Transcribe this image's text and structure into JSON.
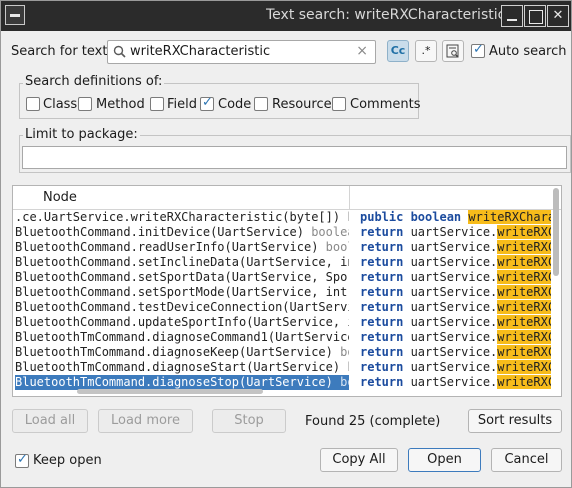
{
  "window": {
    "title": "Text search: writeRXCharacteristic"
  },
  "search": {
    "label": "Search for text:",
    "value": "writeRXCharacteristic",
    "auto_search_label": "Auto search",
    "auto_search_checked": true,
    "toggle_case_label": "Cc",
    "toggle_regex_label": ".*"
  },
  "definitions": {
    "title": "Search definitions of:",
    "items": [
      {
        "label": "Class",
        "checked": false
      },
      {
        "label": "Method",
        "checked": false
      },
      {
        "label": "Field",
        "checked": false
      },
      {
        "label": "Code",
        "checked": true
      },
      {
        "label": "Resource",
        "checked": false
      },
      {
        "label": "Comments",
        "checked": false
      }
    ]
  },
  "package": {
    "title": "Limit to package:",
    "value": ""
  },
  "table": {
    "header": "Node",
    "rows": [
      {
        "node": ".ce.UartService.writeRXCharacteristic(byte[])",
        "sig": " boo",
        "kw": "public boolean ",
        "pre": "",
        "hl": "writeRXCharac",
        "selected": false
      },
      {
        "node": "BluetoothCommand.initDevice(UartService)",
        "sig": " boolean",
        "kw": "return ",
        "pre": "uartService.",
        "hl": "writeRXCh",
        "selected": false
      },
      {
        "node": "BluetoothCommand.readUserInfo(UartService)",
        "sig": " boole",
        "kw": "return ",
        "pre": "uartService.",
        "hl": "writeRXCh",
        "selected": false
      },
      {
        "node": "BluetoothCommand.setInclineData(UartService, int",
        "sig": "",
        "kw": "return ",
        "pre": "uartService.",
        "hl": "writeRXCh",
        "selected": false
      },
      {
        "node": "BluetoothCommand.setSportData(UartService, Sport",
        "sig": "",
        "kw": "return ",
        "pre": "uartService.",
        "hl": "writeRXCh",
        "selected": false
      },
      {
        "node": "BluetoothCommand.setSportMode(UartService, int,",
        "sig": "",
        "kw": "return ",
        "pre": "uartService.",
        "hl": "writeRXCh",
        "selected": false
      },
      {
        "node": "BluetoothCommand.testDeviceConnection(UartServic",
        "sig": "",
        "kw": "return ",
        "pre": "uartService.",
        "hl": "writeRXCh",
        "selected": false
      },
      {
        "node": "BluetoothCommand.updateSportInfo(UartService, in",
        "sig": "",
        "kw": "return ",
        "pre": "uartService.",
        "hl": "writeRXCh",
        "selected": false
      },
      {
        "node": "BluetoothTmCommand.diagnoseCommand1(UartService,",
        "sig": "",
        "kw": "return ",
        "pre": "uartService.",
        "hl": "writeRXCh",
        "selected": false
      },
      {
        "node": "BluetoothTmCommand.diagnoseKeep(UartService)",
        "sig": " bo",
        "kw": "return ",
        "pre": "uartService.",
        "hl": "writeRXCh",
        "selected": false
      },
      {
        "node": "BluetoothTmCommand.diagnoseStart(UartService)",
        "sig": " bo",
        "kw": "return ",
        "pre": "uartService.",
        "hl": "writeRXCh",
        "selected": false
      },
      {
        "node": "BluetoothTmCommand.diagnoseStop(UartService)",
        "sig": " boo",
        "kw": "return ",
        "pre": "uartService.",
        "hl": "writeRXCh",
        "selected": true
      }
    ]
  },
  "footer": {
    "load_all": "Load all",
    "load_more": "Load more",
    "stop": "Stop",
    "status": "Found 25 (complete)",
    "sort_results": "Sort results",
    "keep_open": "Keep open",
    "keep_open_checked": true,
    "copy_all": "Copy All",
    "open": "Open",
    "cancel": "Cancel"
  },
  "colors": {
    "accent": "#3d7bbd",
    "highlight": "#f7bc1b",
    "keyword": "#1b4b9e",
    "titlebar": "#2b2b2b"
  }
}
